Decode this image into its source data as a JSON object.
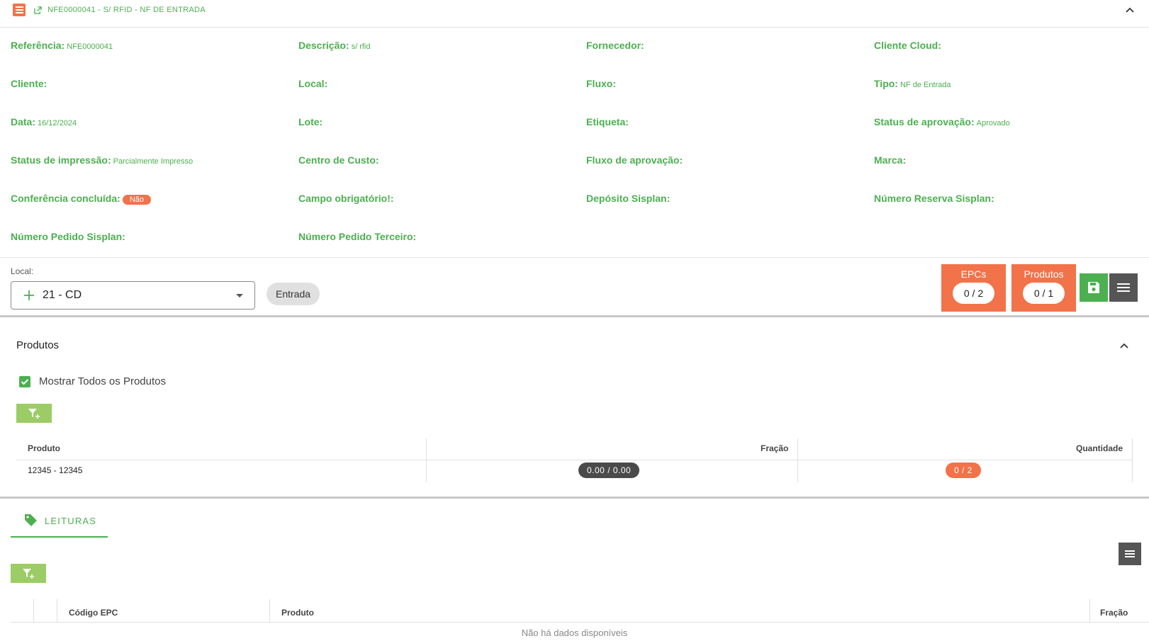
{
  "header": {
    "title": "NFE0000041 - S/ RFID - NF DE ENTRADA"
  },
  "info": {
    "referencia": {
      "label": "Referência:",
      "value": "NFE0000041"
    },
    "descricao": {
      "label": "Descrição:",
      "value": "s/ rfid"
    },
    "fornecedor": {
      "label": "Fornecedor:",
      "value": ""
    },
    "cliente_cloud": {
      "label": "Cliente Cloud:",
      "value": ""
    },
    "cliente": {
      "label": "Cliente:",
      "value": ""
    },
    "local": {
      "label": "Local:",
      "value": ""
    },
    "fluxo": {
      "label": "Fluxo:",
      "value": ""
    },
    "tipo": {
      "label": "Tipo:",
      "value": "NF de Entrada"
    },
    "data": {
      "label": "Data:",
      "value": "16/12/2024"
    },
    "lote": {
      "label": "Lote:",
      "value": ""
    },
    "etiqueta": {
      "label": "Etiqueta:",
      "value": ""
    },
    "status_aprovacao": {
      "label": "Status de aprovação:",
      "value": "Aprovado"
    },
    "status_impressao": {
      "label": "Status de impressão:",
      "value": "Parcialmente Impresso"
    },
    "centro_custo": {
      "label": "Centro de Custo:",
      "value": ""
    },
    "fluxo_aprovacao": {
      "label": "Fluxo de aprovação:",
      "value": ""
    },
    "marca": {
      "label": "Marca:",
      "value": ""
    },
    "conferencia": {
      "label": "Conferência concluída:",
      "value": "Não"
    },
    "campo_obrigatorio": {
      "label": "Campo obrigatório!:",
      "value": ""
    },
    "deposito": {
      "label": "Depósito Sisplan:",
      "value": ""
    },
    "numero_reserva": {
      "label": "Número Reserva Sisplan:",
      "value": ""
    },
    "numero_pedido": {
      "label": "Número Pedido Sisplan:",
      "value": ""
    },
    "numero_pedido_terceiro": {
      "label": "Número Pedido Terceiro:",
      "value": ""
    }
  },
  "toolbar": {
    "local_label": "Local:",
    "local_value": "21 - CD",
    "mode_chip": "Entrada",
    "epcs_label": "EPCs",
    "epcs_value": "0 / 2",
    "produtos_label": "Produtos",
    "produtos_value": "0 / 1"
  },
  "produtos": {
    "title": "Produtos",
    "show_all_label": "Mostrar Todos os Produtos",
    "columns": [
      "Produto",
      "Fração",
      "Quantidade"
    ],
    "rows": [
      {
        "produto": "12345 - 12345",
        "fracao": "0.00 / 0.00",
        "quantidade": "0 / 2"
      }
    ]
  },
  "leituras": {
    "tab_label": "LEITURAS",
    "columns": [
      "Código EPC",
      "Produto",
      "Fração"
    ],
    "empty_message": "Não há dados disponíveis"
  },
  "colors": {
    "accent_green": "#4caf50",
    "accent_orange": "#f2724a",
    "filter_green": "#9ccc65",
    "dark": "#555555"
  }
}
